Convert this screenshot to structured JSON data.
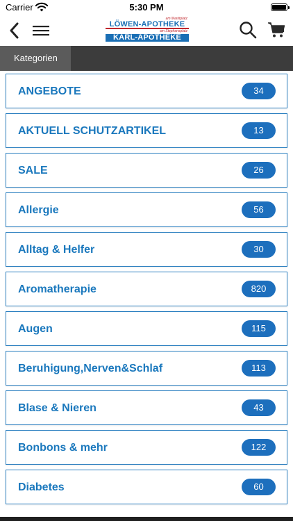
{
  "status_bar": {
    "carrier": "Carrier",
    "time": "5:30 PM"
  },
  "header": {
    "logo": {
      "line1_sub": "am Marktplatz",
      "line1_main": "LÖWEN-APOTHEKE",
      "line2_sub": "am Stephansplatz",
      "line2_main": "KARL-APOTHEKE"
    },
    "icons": [
      "back-icon",
      "menu-icon",
      "search-icon",
      "cart-icon"
    ]
  },
  "tabs": [
    {
      "label": "Kategorien",
      "active": true
    }
  ],
  "categories": [
    {
      "label": "ANGEBOTE",
      "count": "34"
    },
    {
      "label": "AKTUELL SCHUTZARTIKEL",
      "count": "13"
    },
    {
      "label": "SALE",
      "count": "26"
    },
    {
      "label": "Allergie",
      "count": "56"
    },
    {
      "label": "Alltag & Helfer",
      "count": "30"
    },
    {
      "label": "Aromatherapie",
      "count": "820"
    },
    {
      "label": "Augen",
      "count": "115"
    },
    {
      "label": "Beruhigung,Nerven&Schlaf",
      "count": "113"
    },
    {
      "label": "Blase & Nieren",
      "count": "43"
    },
    {
      "label": "Bonbons & mehr",
      "count": "122"
    },
    {
      "label": "Diabetes",
      "count": "60"
    }
  ],
  "colors": {
    "accent": "#1a78bd",
    "badge": "#1d6fbd",
    "tabbar": "#3c3c3c",
    "tab_active": "#5b5b5b",
    "brand_red": "#c0272d"
  }
}
